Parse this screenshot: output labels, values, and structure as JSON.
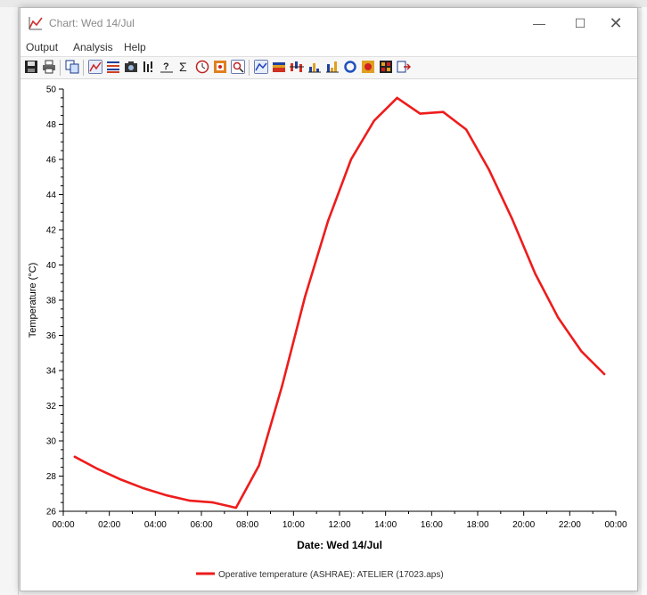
{
  "window": {
    "title": "Chart: Wed 14/Jul",
    "minimize_label": "—",
    "maximize_label": "☐",
    "close_label": "✕"
  },
  "menu": {
    "items": [
      "Output",
      "Analysis",
      "Help"
    ]
  },
  "toolbar": {
    "icons": [
      "save-icon",
      "print-icon",
      "copy-icon",
      "line-chart-icon",
      "table-icon",
      "camera-icon",
      "bar-marker-icon",
      "question-axis-icon",
      "sigma-icon",
      "clock-icon",
      "stop-frame-icon",
      "zoom-chart-icon",
      "line-chart-2-icon",
      "stacked-area-icon",
      "floating-bar-icon",
      "bar-chart-icon",
      "column-chart-icon",
      "ring-icon",
      "heatmap-icon",
      "grid-heatmap-icon",
      "export-icon"
    ]
  },
  "colors": {
    "series_line": "#ee1c1c",
    "axis": "#000000"
  },
  "chart_data": {
    "type": "line",
    "xlabel": "Date: Wed 14/Jul",
    "ylabel": "Temperature (°C)",
    "x_tick_labels": [
      "00:00",
      "02:00",
      "04:00",
      "06:00",
      "08:00",
      "10:00",
      "12:00",
      "14:00",
      "16:00",
      "18:00",
      "20:00",
      "22:00",
      "00:00"
    ],
    "y_tick_labels": [
      "26",
      "28",
      "30",
      "32",
      "34",
      "36",
      "38",
      "40",
      "42",
      "44",
      "46",
      "48",
      "50"
    ],
    "xlim_hours": [
      0,
      24
    ],
    "ylim": [
      26,
      50
    ],
    "grid": false,
    "legend_position": "bottom",
    "series": [
      {
        "name": "Operative temperature (ASHRAE): ATELIER (17023.aps)",
        "x_hours": [
          0.5,
          1.5,
          2.5,
          3.5,
          4.5,
          5.5,
          6.5,
          7.5,
          8.5,
          9.5,
          10.5,
          11.5,
          12.5,
          13.5,
          14.5,
          15.5,
          16.5,
          17.5,
          18.5,
          19.5,
          20.5,
          21.5,
          22.5,
          23.5
        ],
        "values": [
          29.1,
          28.4,
          27.8,
          27.3,
          26.9,
          26.6,
          26.5,
          26.2,
          28.6,
          33.1,
          38.2,
          42.5,
          46.0,
          48.2,
          49.5,
          48.6,
          48.7,
          47.7,
          45.4,
          42.6,
          39.5,
          37.0,
          35.1,
          33.8
        ]
      }
    ]
  }
}
